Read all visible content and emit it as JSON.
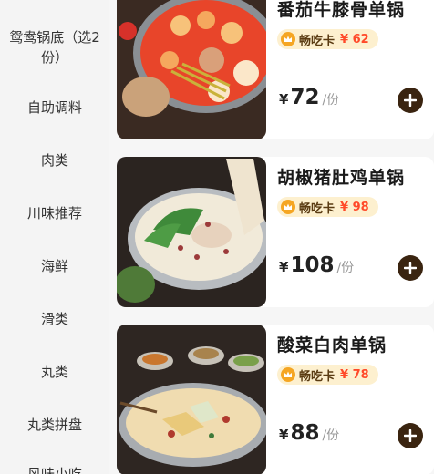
{
  "sidebar": {
    "items": [
      {
        "label_line1": "鸳鸯锅底（选2",
        "label_line2": "份）"
      },
      {
        "label": "自助调料"
      },
      {
        "label": "肉类"
      },
      {
        "label": "川味推荐"
      },
      {
        "label": "海鲜"
      },
      {
        "label": "滑类"
      },
      {
        "label": "丸类"
      },
      {
        "label": "丸类拼盘"
      },
      {
        "label": "风味小吃"
      }
    ]
  },
  "products": [
    {
      "name": "番茄牛膝骨单锅",
      "card_label": "畅吃卡",
      "card_price": "¥ 62",
      "currency": "¥",
      "price": "72",
      "unit": "/份",
      "image": "tomato-hotpot-image"
    },
    {
      "name": "胡椒猪肚鸡单锅",
      "card_label": "畅吃卡",
      "card_price": "¥ 98",
      "currency": "¥",
      "price": "108",
      "unit": "/份",
      "image": "pepper-tripe-chicken-hotpot-image"
    },
    {
      "name": "酸菜白肉单锅",
      "card_label": "畅吃卡",
      "card_price": "¥ 78",
      "currency": "¥",
      "price": "88",
      "unit": "/份",
      "image": "pickled-cabbage-pork-hotpot-image"
    }
  ],
  "colors": {
    "sidebar_bg": "#f4f4f4",
    "badge_bg": "#fdf0cf",
    "badge_price": "#ff4a2a",
    "add_button": "#3a2410"
  }
}
